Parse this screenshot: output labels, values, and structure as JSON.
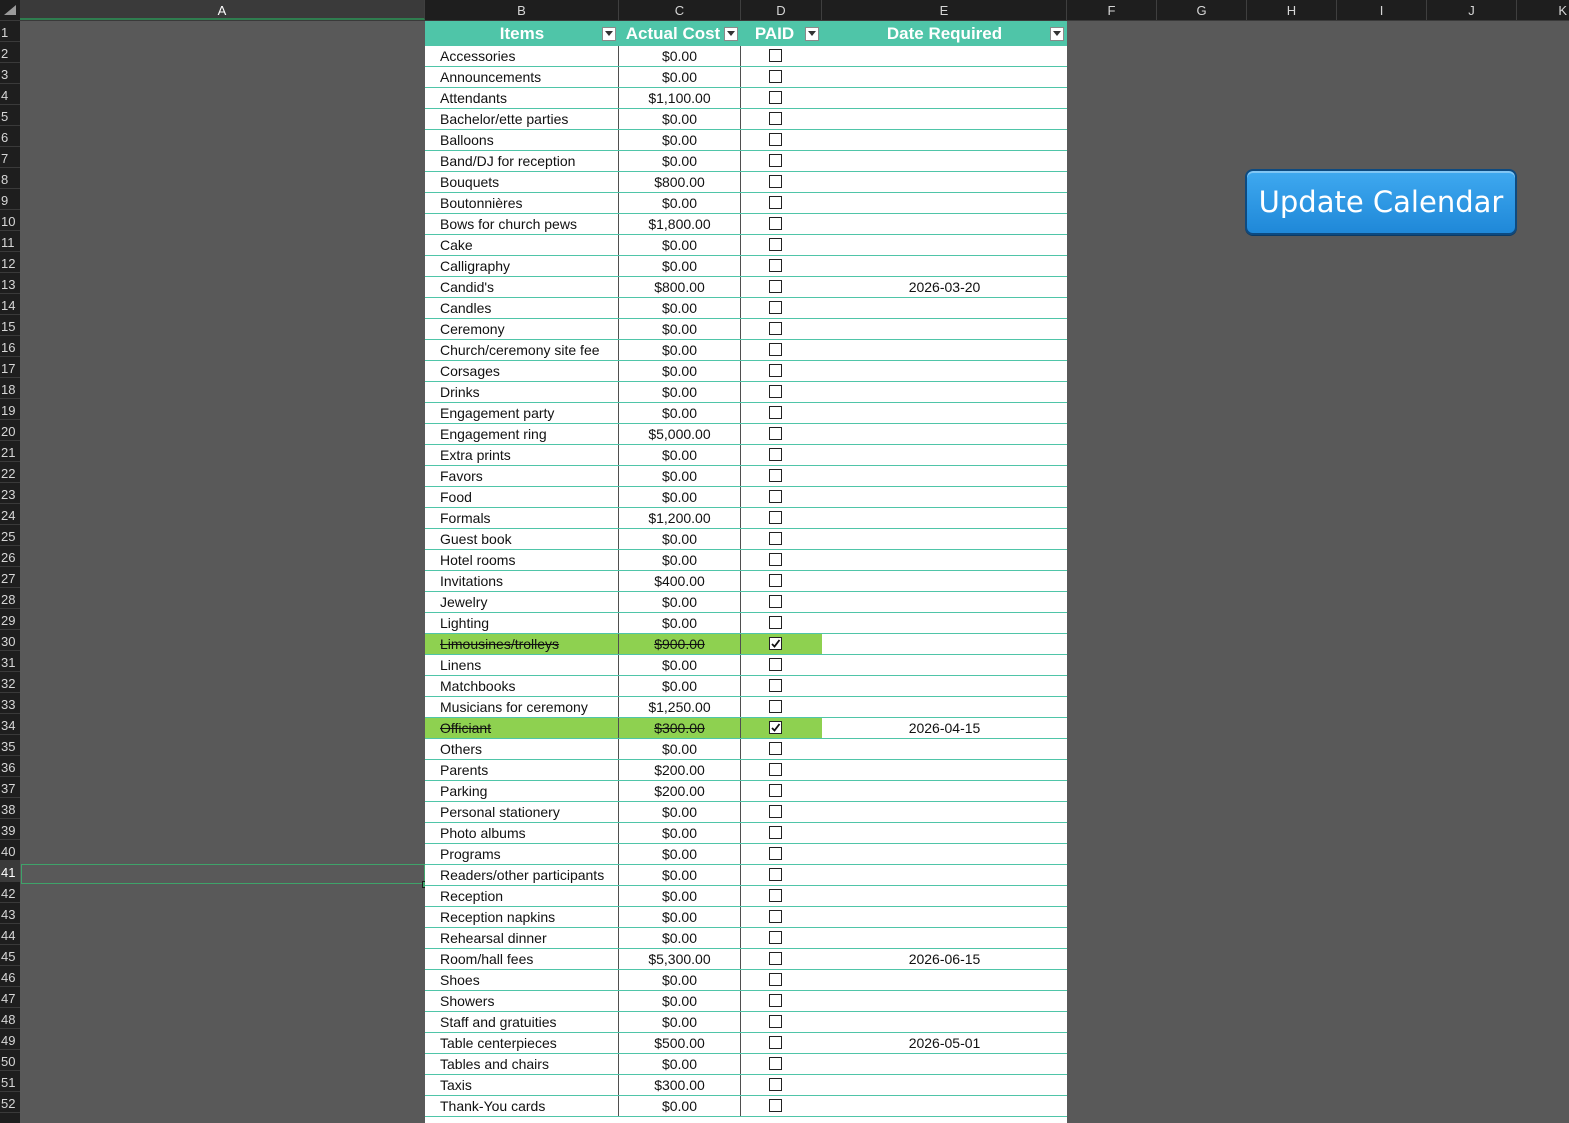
{
  "columns": [
    "A",
    "B",
    "C",
    "D",
    "E",
    "F",
    "G",
    "H",
    "I",
    "J",
    "K"
  ],
  "header": {
    "items": "Items",
    "actual_cost": "Actual Cost",
    "paid": "PAID",
    "date_required": "Date Required"
  },
  "button": {
    "update_calendar": "Update Calendar"
  },
  "selected_row": 41,
  "rows": [
    {
      "item": "Accessories",
      "cost": "$0.00",
      "paid": false,
      "date": ""
    },
    {
      "item": "Announcements",
      "cost": "$0.00",
      "paid": false,
      "date": ""
    },
    {
      "item": "Attendants",
      "cost": "$1,100.00",
      "paid": false,
      "date": ""
    },
    {
      "item": "Bachelor/ette parties",
      "cost": "$0.00",
      "paid": false,
      "date": ""
    },
    {
      "item": "Balloons",
      "cost": "$0.00",
      "paid": false,
      "date": ""
    },
    {
      "item": "Band/DJ for reception",
      "cost": "$0.00",
      "paid": false,
      "date": ""
    },
    {
      "item": "Bouquets",
      "cost": "$800.00",
      "paid": false,
      "date": ""
    },
    {
      "item": "Boutonnières",
      "cost": "$0.00",
      "paid": false,
      "date": ""
    },
    {
      "item": "Bows for church pews",
      "cost": "$1,800.00",
      "paid": false,
      "date": ""
    },
    {
      "item": "Cake",
      "cost": "$0.00",
      "paid": false,
      "date": ""
    },
    {
      "item": "Calligraphy",
      "cost": "$0.00",
      "paid": false,
      "date": ""
    },
    {
      "item": "Candid's",
      "cost": "$800.00",
      "paid": false,
      "date": "2026-03-20"
    },
    {
      "item": "Candles",
      "cost": "$0.00",
      "paid": false,
      "date": ""
    },
    {
      "item": "Ceremony",
      "cost": "$0.00",
      "paid": false,
      "date": ""
    },
    {
      "item": "Church/ceremony site fee",
      "cost": "$0.00",
      "paid": false,
      "date": ""
    },
    {
      "item": "Corsages",
      "cost": "$0.00",
      "paid": false,
      "date": ""
    },
    {
      "item": "Drinks",
      "cost": "$0.00",
      "paid": false,
      "date": ""
    },
    {
      "item": "Engagement party",
      "cost": "$0.00",
      "paid": false,
      "date": ""
    },
    {
      "item": "Engagement ring",
      "cost": "$5,000.00",
      "paid": false,
      "date": ""
    },
    {
      "item": "Extra prints",
      "cost": "$0.00",
      "paid": false,
      "date": ""
    },
    {
      "item": "Favors",
      "cost": "$0.00",
      "paid": false,
      "date": ""
    },
    {
      "item": "Food",
      "cost": "$0.00",
      "paid": false,
      "date": ""
    },
    {
      "item": "Formals",
      "cost": "$1,200.00",
      "paid": false,
      "date": ""
    },
    {
      "item": "Guest book",
      "cost": "$0.00",
      "paid": false,
      "date": ""
    },
    {
      "item": "Hotel rooms",
      "cost": "$0.00",
      "paid": false,
      "date": ""
    },
    {
      "item": "Invitations",
      "cost": "$400.00",
      "paid": false,
      "date": ""
    },
    {
      "item": "Jewelry",
      "cost": "$0.00",
      "paid": false,
      "date": ""
    },
    {
      "item": "Lighting",
      "cost": "$0.00",
      "paid": false,
      "date": ""
    },
    {
      "item": "Limousines/trolleys",
      "cost": "$900.00",
      "paid": true,
      "date": ""
    },
    {
      "item": "Linens",
      "cost": "$0.00",
      "paid": false,
      "date": ""
    },
    {
      "item": "Matchbooks",
      "cost": "$0.00",
      "paid": false,
      "date": ""
    },
    {
      "item": "Musicians for ceremony",
      "cost": "$1,250.00",
      "paid": false,
      "date": ""
    },
    {
      "item": "Officiant",
      "cost": "$300.00",
      "paid": true,
      "date": "2026-04-15"
    },
    {
      "item": "Others",
      "cost": "$0.00",
      "paid": false,
      "date": ""
    },
    {
      "item": "Parents",
      "cost": "$200.00",
      "paid": false,
      "date": ""
    },
    {
      "item": "Parking",
      "cost": "$200.00",
      "paid": false,
      "date": ""
    },
    {
      "item": "Personal stationery",
      "cost": "$0.00",
      "paid": false,
      "date": ""
    },
    {
      "item": "Photo albums",
      "cost": "$0.00",
      "paid": false,
      "date": ""
    },
    {
      "item": "Programs",
      "cost": "$0.00",
      "paid": false,
      "date": ""
    },
    {
      "item": "Readers/other participants",
      "cost": "$0.00",
      "paid": false,
      "date": ""
    },
    {
      "item": "Reception",
      "cost": "$0.00",
      "paid": false,
      "date": ""
    },
    {
      "item": "Reception napkins",
      "cost": "$0.00",
      "paid": false,
      "date": ""
    },
    {
      "item": "Rehearsal dinner",
      "cost": "$0.00",
      "paid": false,
      "date": ""
    },
    {
      "item": "Room/hall fees",
      "cost": "$5,300.00",
      "paid": false,
      "date": "2026-06-15"
    },
    {
      "item": "Shoes",
      "cost": "$0.00",
      "paid": false,
      "date": ""
    },
    {
      "item": "Showers",
      "cost": "$0.00",
      "paid": false,
      "date": ""
    },
    {
      "item": "Staff and gratuities",
      "cost": "$0.00",
      "paid": false,
      "date": ""
    },
    {
      "item": "Table centerpieces",
      "cost": "$500.00",
      "paid": false,
      "date": "2026-05-01"
    },
    {
      "item": "Tables and chairs",
      "cost": "$0.00",
      "paid": false,
      "date": ""
    },
    {
      "item": "Taxis",
      "cost": "$300.00",
      "paid": false,
      "date": ""
    },
    {
      "item": "Thank-You cards",
      "cost": "$0.00",
      "paid": false,
      "date": ""
    }
  ],
  "row_numbers": [
    "1",
    "2",
    "3",
    "4",
    "5",
    "6",
    "7",
    "8",
    "9",
    "10",
    "11",
    "12",
    "13",
    "14",
    "15",
    "16",
    "17",
    "18",
    "19",
    "20",
    "21",
    "22",
    "23",
    "24",
    "25",
    "26",
    "27",
    "28",
    "29",
    "30",
    "31",
    "32",
    "33",
    "34",
    "35",
    "36",
    "37",
    "38",
    "39",
    "40",
    "41",
    "42",
    "43",
    "44",
    "45",
    "46",
    "47",
    "48",
    "49",
    "50",
    "51",
    "52"
  ],
  "colors": {
    "header_accent": "#4fc5a8",
    "paid_highlight": "#8ed150",
    "button_blue": "#2a97e4"
  }
}
